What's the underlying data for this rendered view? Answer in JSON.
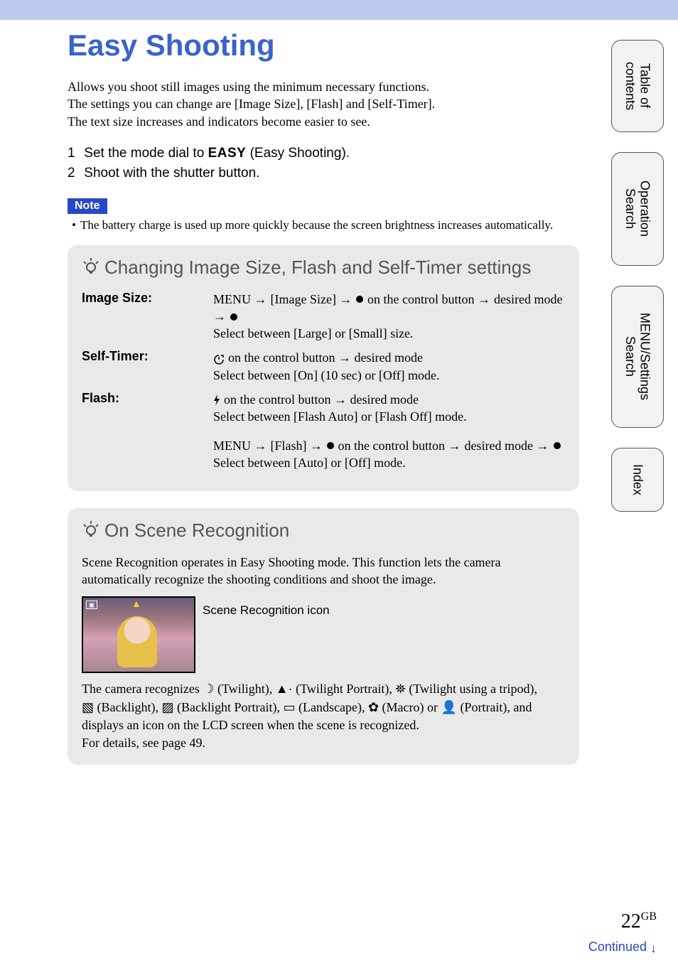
{
  "title": "Easy Shooting",
  "intro": {
    "line1": "Allows you shoot still images using the minimum necessary functions.",
    "line2": "The settings you can change are [Image Size], [Flash] and [Self-Timer].",
    "line3": "The text size increases and indicators become easier to see."
  },
  "steps": {
    "s1a": "Set the mode dial to ",
    "s1_easy": "EASY",
    "s1b": " (Easy Shooting).",
    "s2": "Shoot with the shutter button."
  },
  "note": {
    "label": "Note",
    "text": "The battery charge is used up more quickly because the screen brightness increases automatically."
  },
  "tip1": {
    "title": "Changing Image Size, Flash and Self-Timer settings",
    "rows": {
      "image_size": {
        "label": "Image Size:",
        "menu": "MENU",
        "item": "[Image Size]",
        "ctrl": "on the control button",
        "tail": "desired mode",
        "line2": "Select between [Large] or [Small] size."
      },
      "self_timer": {
        "label": "Self-Timer:",
        "line1a": " on the control button ",
        "line1b": " desired mode",
        "line2": "Select between [On] (10 sec) or [Off] mode."
      },
      "flash": {
        "label": "Flash:",
        "line1a": " on the control button ",
        "line1b": " desired mode",
        "line2": "Select between [Flash Auto] or [Flash Off] mode.",
        "menu": "MENU",
        "item": "[Flash]",
        "ctrl": "on the control button",
        "tail": "desired mode",
        "line4": "Select between [Auto] or [Off] mode."
      }
    }
  },
  "tip2": {
    "title": "On Scene Recognition",
    "intro": "Scene Recognition operates in Easy Shooting mode. This function lets the camera automatically recognize the shooting conditions and shoot the image.",
    "callout": "Scene Recognition icon",
    "list_pre": "The camera recognizes ",
    "modes": {
      "twilight": " (Twilight), ",
      "twilight_portrait": " (Twilight Portrait), ",
      "twilight_tripod": " (Twilight using a tripod), ",
      "backlight": " (Backlight), ",
      "backlight_portrait": " (Backlight Portrait), ",
      "landscape": " (Landscape), ",
      "macro": " (Macro) or ",
      "portrait": " (Portrait), and"
    },
    "list_post1": "displays an icon on the LCD screen when the scene is recognized.",
    "list_post2": "For details, see page 49."
  },
  "tabs": [
    "Table of contents",
    "Operation Search",
    "MENU/Settings Search",
    "Index"
  ],
  "page": {
    "num": "22",
    "region": "GB"
  },
  "continued": "Continued"
}
